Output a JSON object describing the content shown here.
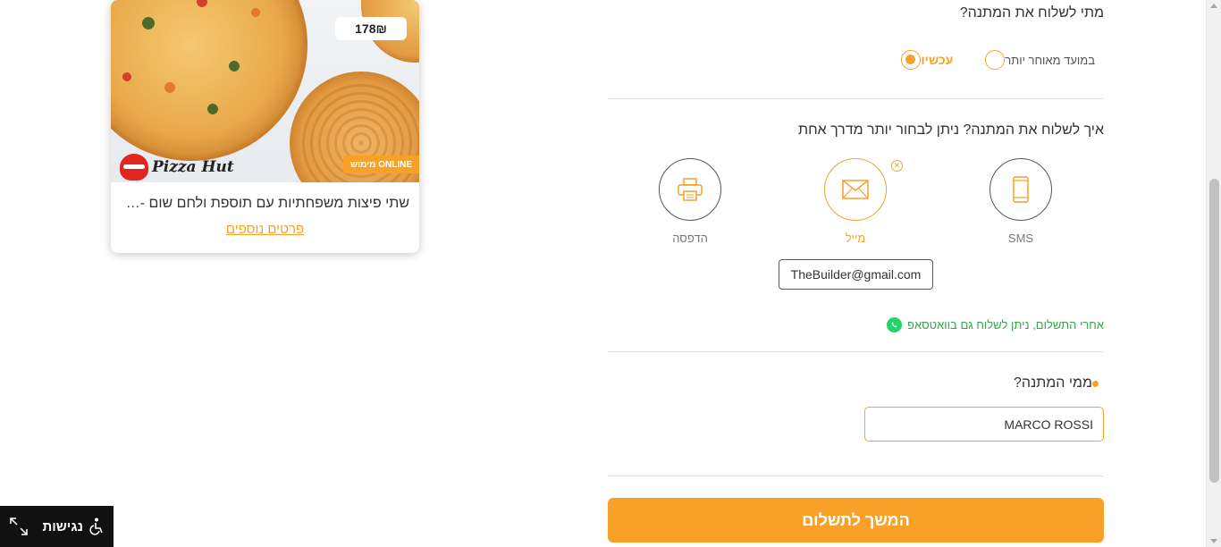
{
  "product_card": {
    "price": "178₪",
    "brand": "Pizza Hut",
    "online_badge": "מימוש ONLINE",
    "title": "שתי פיצות משפחתיות עם תוספת ולחם שום - במ...",
    "details_link": "פרטים נוספים"
  },
  "gift_form": {
    "when_question": "מתי לשלוח את המתנה?",
    "when_options": [
      {
        "label": "עכשיו",
        "selected": true
      },
      {
        "label": "במועד מאוחר יותר",
        "selected": false
      }
    ],
    "how_question": "איך לשלוח את המתנה? ניתן לבחור יותר מדרך אחת",
    "methods": [
      {
        "label": "SMS",
        "icon": "phone-icon",
        "selected": false
      },
      {
        "label": "מייל",
        "icon": "envelope-icon",
        "selected": true
      },
      {
        "label": "הדפסה",
        "icon": "printer-icon",
        "selected": false
      }
    ],
    "email_value": "TheBuilder@gmail.com",
    "whatsapp_note": "אחרי התשלום, ניתן לשלוח גם בוואטסאפ",
    "from_question": "ממי המתנה?",
    "from_value": "MARCO ROSSI",
    "continue_button": "המשך לתשלום"
  },
  "accessibility": {
    "label": "נגישות"
  },
  "colors": {
    "accent": "#f7a128",
    "whatsapp": "#25d366",
    "whatsapp_text": "#3aa34a"
  }
}
